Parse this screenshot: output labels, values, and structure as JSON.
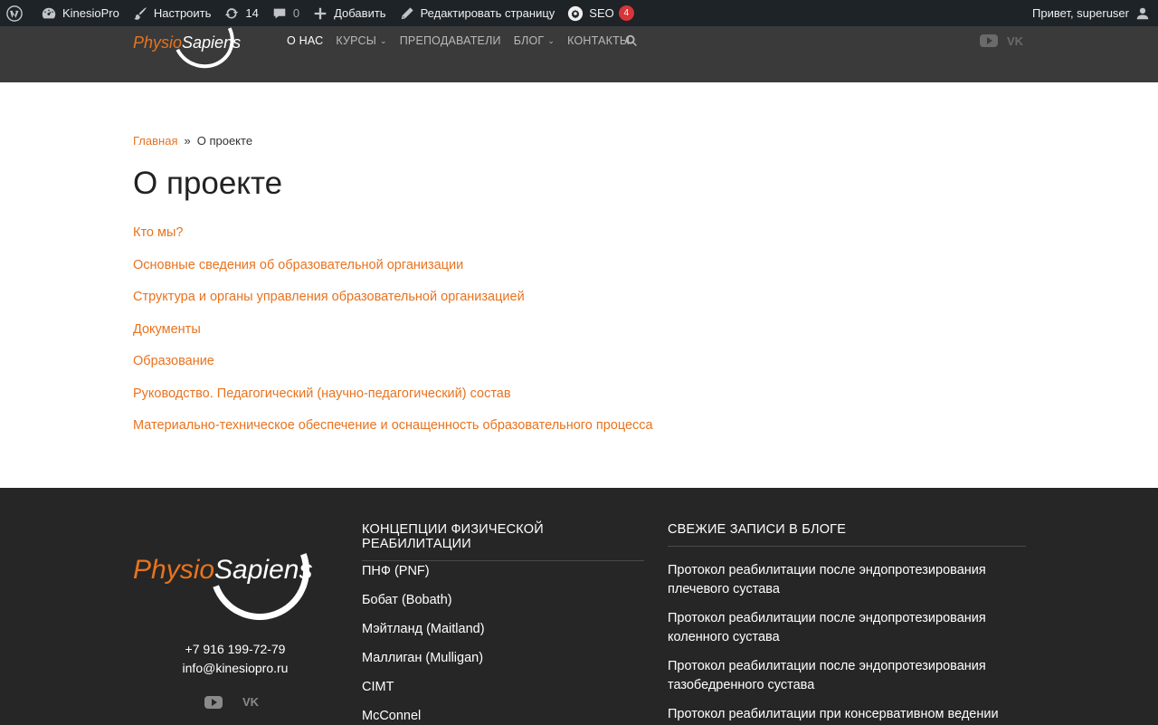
{
  "admin_bar": {
    "site_name": "KinesioPro",
    "customize": "Настроить",
    "updates_count": "14",
    "comments_count": "0",
    "add_new": "Добавить",
    "edit_page": "Редактировать страницу",
    "seo": "SEO",
    "seo_badge": "4",
    "greeting": "Привет, superuser"
  },
  "header": {
    "logo_physio": "Physio",
    "logo_sapiens": "Sapiens",
    "nav": [
      {
        "label": "О НАС",
        "active": true
      },
      {
        "label": "КУРСЫ",
        "dropdown": true
      },
      {
        "label": "ПРЕПОДАВАТЕЛИ"
      },
      {
        "label": "БЛОГ",
        "dropdown": true
      },
      {
        "label": "КОНТАКТЫ"
      }
    ],
    "caret": "⌄",
    "vk": "VK"
  },
  "breadcrumb": {
    "home": "Главная",
    "sep": "»",
    "current": "О проекте"
  },
  "page_title": "О проекте",
  "links": [
    "Кто мы?",
    "Основные сведения об образовательной организации",
    "Структура и органы управления образовательной организацией",
    "Документы",
    "Образование",
    "Руководство. Педагогический (научно-педагогический) состав",
    "Материально-техническое обеспечение и оснащенность образовательного процесса"
  ],
  "footer": {
    "logo_physio": "Physio",
    "logo_sapiens": "Sapiens",
    "phone": "+7 916 199-72-79",
    "email": "info@kinesiopro.ru",
    "vk": "VK",
    "concepts_title": "КОНЦЕПЦИИ ФИЗИЧЕСКОЙ РЕАБИЛИТАЦИИ",
    "concepts": [
      "ПНФ (PNF)",
      "Бобат (Bobath)",
      "Мэйтланд (Maitland)",
      "Маллиган (Mulligan)",
      "CIMT",
      "McConnel"
    ],
    "posts_title": "СВЕЖИЕ ЗАПИСИ В БЛОГЕ",
    "posts": [
      "Протокол реабилитации после эндопротезирования плечевого сустава",
      "Протокол реабилитации после эндопротезирования коленного сустава",
      "Протокол реабилитации после эндопротезирования тазобедренного сустава",
      "Протокол реабилитации при консервативном ведении"
    ]
  },
  "colors": {
    "accent": "#e8731f",
    "admin_bar": "#1d2327",
    "header": "#3a3a3a",
    "footer": "#262626"
  }
}
